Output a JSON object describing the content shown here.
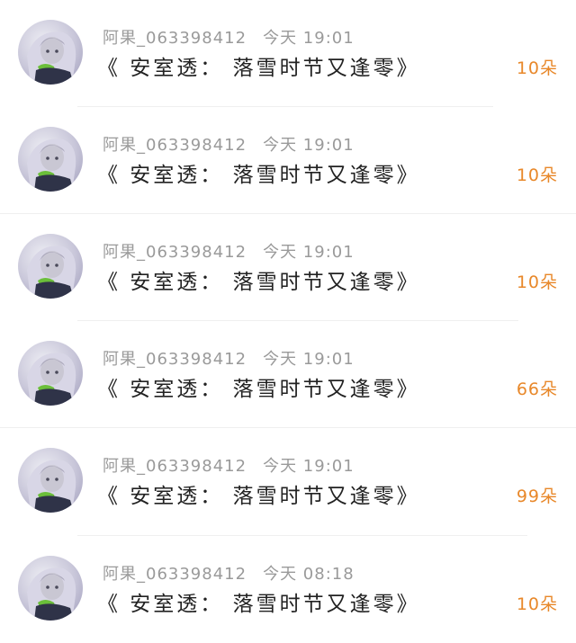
{
  "messages": [
    {
      "user": "阿果_063398412",
      "time": "今天 19:01",
      "text": "《 安室透： 落雪时节又逢零》",
      "gift": "10朵"
    },
    {
      "user": "阿果_063398412",
      "time": "今天 19:01",
      "text": "《 安室透： 落雪时节又逢零》",
      "gift": "10朵"
    },
    {
      "user": "阿果_063398412",
      "time": "今天 19:01",
      "text": "《 安室透： 落雪时节又逢零》",
      "gift": "10朵"
    },
    {
      "user": "阿果_063398412",
      "time": "今天 19:01",
      "text": "《 安室透： 落雪时节又逢零》",
      "gift": "66朵"
    },
    {
      "user": "阿果_063398412",
      "time": "今天 19:01",
      "text": "《 安室透： 落雪时节又逢零》",
      "gift": "99朵"
    },
    {
      "user": "阿果_063398412",
      "time": "今天 08:18",
      "text": "《 安室透： 落雪时节又逢零》",
      "gift": "10朵"
    }
  ],
  "icons": {
    "avatar": "anime-girl-avatar-icon"
  },
  "colors": {
    "gift_accent": "#e8882a",
    "meta_gray": "#9a9a9a",
    "text": "#222222"
  }
}
